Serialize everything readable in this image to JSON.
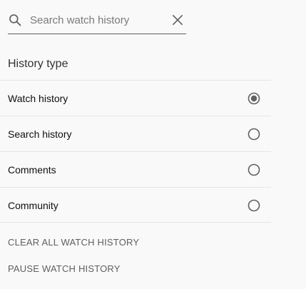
{
  "search": {
    "icon": "search-icon",
    "placeholder": "Search watch history",
    "value": "",
    "clear_icon": "close-icon"
  },
  "history_type": {
    "title": "History type",
    "options": [
      {
        "label": "Watch history",
        "selected": true
      },
      {
        "label": "Search history",
        "selected": false
      },
      {
        "label": "Comments",
        "selected": false
      },
      {
        "label": "Community",
        "selected": false
      }
    ]
  },
  "actions": {
    "clear_all": "CLEAR ALL WATCH HISTORY",
    "pause": "PAUSE WATCH HISTORY"
  },
  "colors": {
    "background": "#f9f9f9",
    "divider": "#e5e5e5",
    "radio": "#606060",
    "action_text": "#606060"
  }
}
